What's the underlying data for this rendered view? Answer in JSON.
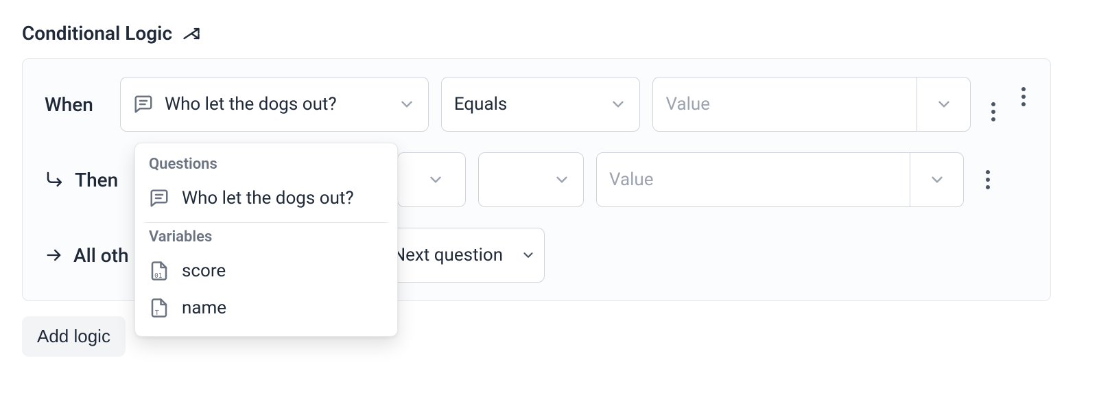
{
  "section_title": "Conditional Logic",
  "when": {
    "label": "When",
    "field_selected": "Who let the dogs out?",
    "operator": "Equals",
    "value_placeholder": "Value"
  },
  "then": {
    "label": "Then",
    "value_placeholder": "Value"
  },
  "else": {
    "label_prefix": "All oth",
    "action": "Next question"
  },
  "popup": {
    "group1_label": "Questions",
    "group1_items": [
      "Who let the dogs out?"
    ],
    "group2_label": "Variables",
    "group2_items": [
      "score",
      "name"
    ]
  },
  "add_logic_label": "Add logic"
}
